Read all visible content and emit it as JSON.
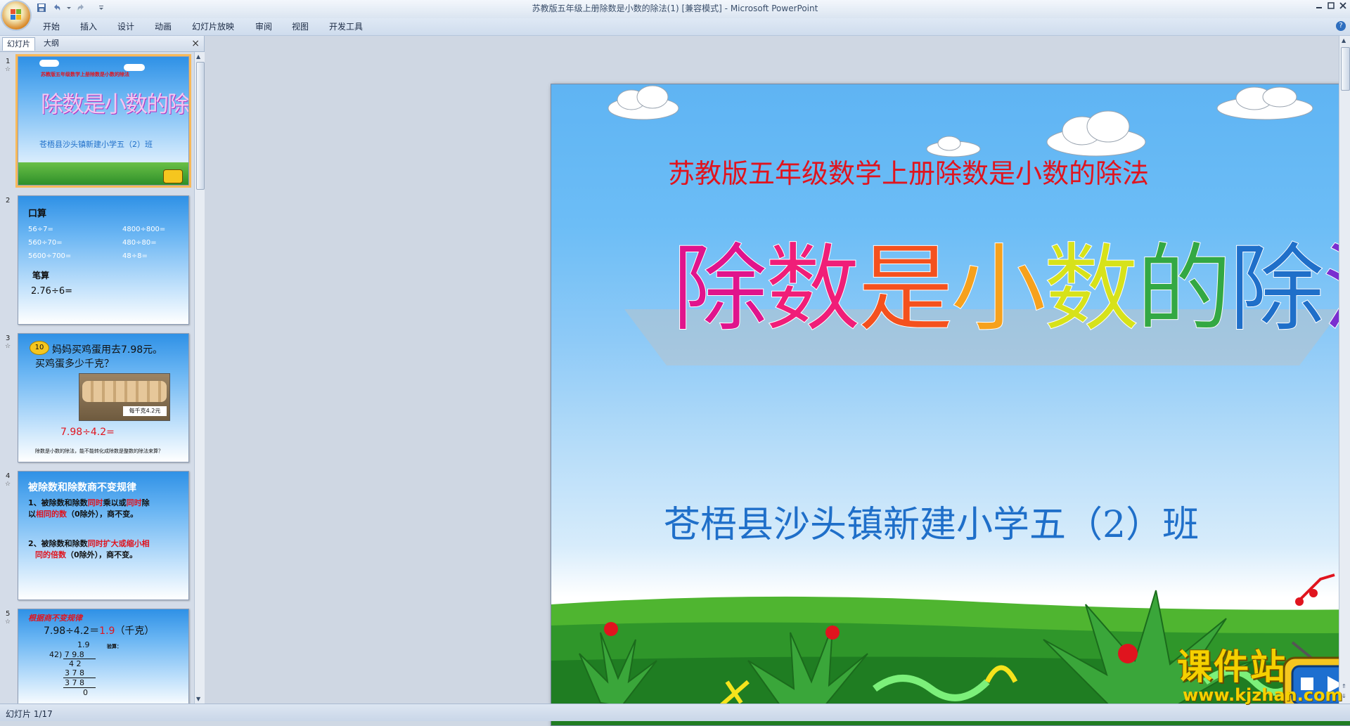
{
  "window": {
    "title": "苏教版五年级上册除数是小数的除法(1) [兼容模式]",
    "title_sep": " - ",
    "app_name": "Microsoft PowerPoint",
    "min_icon": "minimize-glyph",
    "max_icon": "maximize-glyph",
    "close_icon": "close-glyph"
  },
  "ribbon": {
    "tabs": [
      "开始",
      "插入",
      "设计",
      "动画",
      "幻灯片放映",
      "审阅",
      "视图",
      "开发工具"
    ],
    "help_glyph": "?"
  },
  "left_panel": {
    "tab_slides": "幻灯片",
    "tab_outline": "大纲",
    "close_glyph": "×"
  },
  "thumbnails": [
    {
      "num": "1",
      "line1": "苏教版五年级数学上册除数是小数的除法",
      "title": "除数是小数的除法",
      "school": "苍梧县沙头镇新建小学五（2）班"
    },
    {
      "num": "2",
      "heading": "口算",
      "items": [
        [
          "56÷7=",
          "4800÷800="
        ],
        [
          "560÷70=",
          "480÷80="
        ],
        [
          "5600÷700=",
          "48÷8="
        ]
      ],
      "sub_heading": "笔算",
      "problem": "2.76÷6="
    },
    {
      "num": "3",
      "badge": "10",
      "q1": "妈妈买鸡蛋用去7.98元。",
      "q2": "买鸡蛋多少千克？",
      "price_tag": "每千克4.2元",
      "expr": "7.98÷4.2=",
      "note": "除数是小数的除法，能不能转化成除数是整数的除法来算？"
    },
    {
      "num": "4",
      "heading": "被除数和除数商不变规律",
      "r1a": "1、被除数和除数",
      "r1b": "同时",
      "r1c": "乘以或",
      "r1d": "同时",
      "r1e": "除",
      "r1f": "以",
      "r1g": "相同的数",
      "r1h": "（0除外），商不变。",
      "r2a": "2、被除数和除数",
      "r2b": "同时扩大或缩小相",
      "r2c": "同的倍数",
      "r2d": "（0除外），商不变。"
    },
    {
      "num": "5",
      "heading": "根据商不变规律",
      "eq_a": "7.98÷4.2＝",
      "eq_b": "1.9",
      "eq_c": "（千克）",
      "check": "验算：",
      "longdiv": [
        "1.9",
        "42) 7 9.8",
        "4 2",
        "3 7 8",
        "3 7 8",
        "0"
      ]
    }
  ],
  "slide": {
    "subtitle": "苏教版五年级数学上册除数是小数的除法",
    "title_chars": [
      "除",
      "数",
      "是",
      "小",
      "数",
      "的",
      "除",
      "法"
    ],
    "title_colors": [
      "#e0148c",
      "#f01e78",
      "#f4511e",
      "#f6a11d",
      "#d7e21a",
      "#33a843",
      "#1f6fc9",
      "#7a2fd0"
    ],
    "school": "苍梧县沙头镇新建小学五（2）班"
  },
  "status": {
    "slide_count": "幻灯片 1/17"
  },
  "watermark": {
    "cn": "课件站",
    "url": "www.kjzhan.com"
  }
}
